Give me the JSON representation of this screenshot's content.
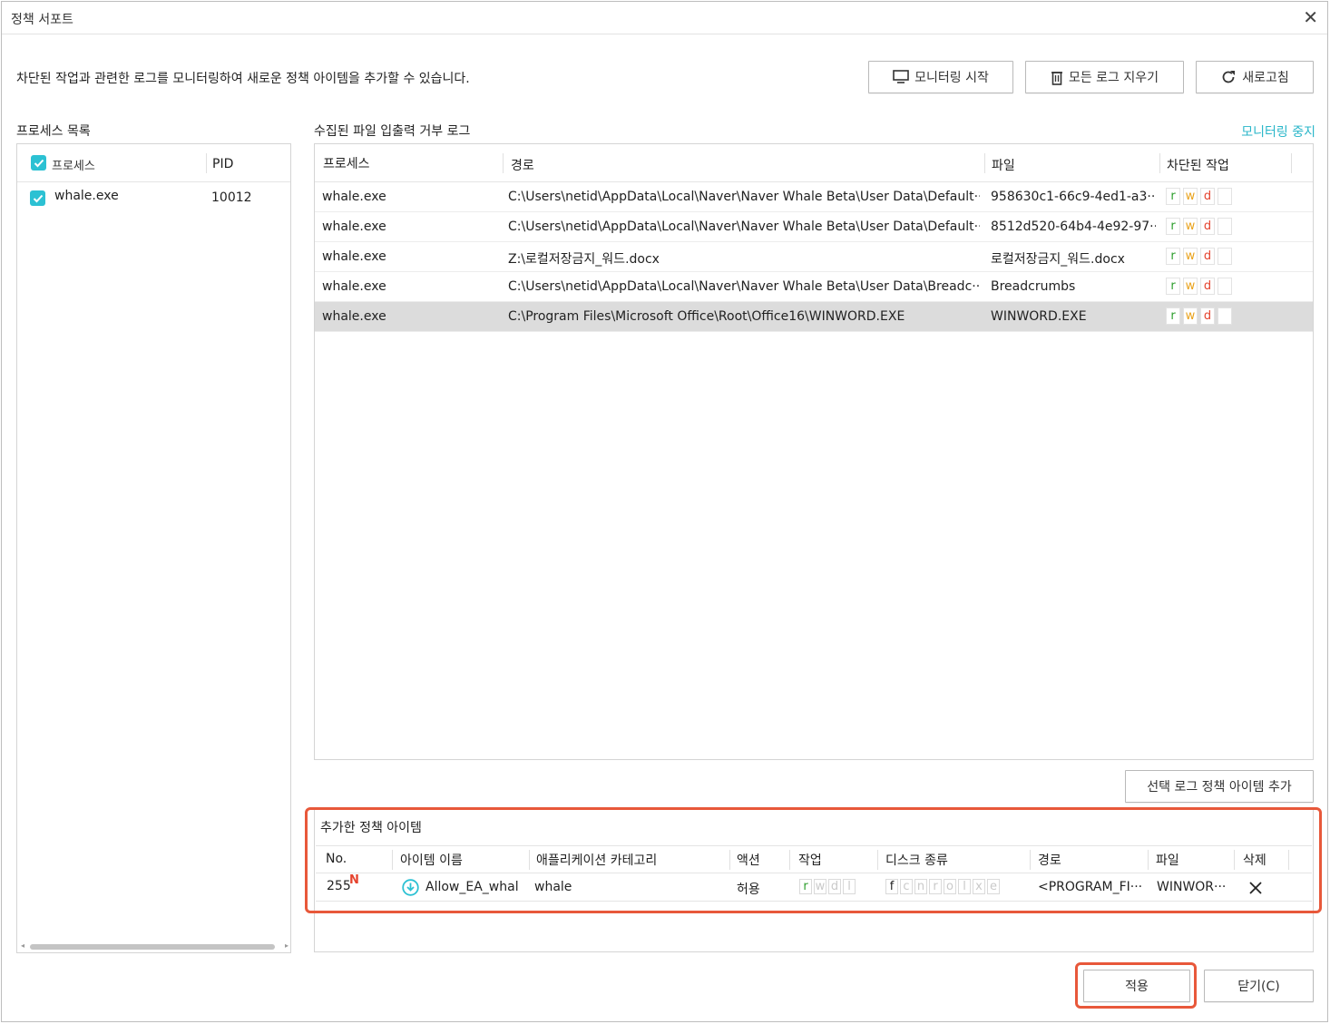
{
  "window": {
    "title": "정책 서포트"
  },
  "description": "차단된 작업과 관련한 로그를 모니터링하여 새로운 정책 아이템을 추가할 수 있습니다.",
  "toolbar": {
    "start_monitoring": "모니터링 시작",
    "clear_logs": "모든 로그 지우기",
    "refresh": "새로고침"
  },
  "process_list": {
    "label": "프로세스 목록",
    "headers": {
      "process": "프로세스",
      "pid": "PID"
    },
    "rows": [
      {
        "name": "whale.exe",
        "pid": "10012",
        "checked": true
      }
    ]
  },
  "log": {
    "label": "수집된 파일 입출력 거부 로그",
    "stop_link": "모니터링 중지",
    "headers": {
      "process": "프로세스",
      "path": "경로",
      "file": "파일",
      "blocked": "차단된 작업"
    },
    "rows": [
      {
        "process": "whale.exe",
        "path": "C:\\Users\\netid\\AppData\\Local\\Naver\\Naver Whale Beta\\User Data\\Default···",
        "file": "958630c1-66c9-4ed1-a3···",
        "ops": [
          "r",
          "w",
          "d"
        ],
        "selected": false
      },
      {
        "process": "whale.exe",
        "path": "C:\\Users\\netid\\AppData\\Local\\Naver\\Naver Whale Beta\\User Data\\Default···",
        "file": "8512d520-64b4-4e92-97···",
        "ops": [
          "r",
          "w",
          "d"
        ],
        "selected": false
      },
      {
        "process": "whale.exe",
        "path": "Z:\\로컬저장금지_워드.docx",
        "file": "로컬저장금지_워드.docx",
        "ops": [
          "r",
          "w",
          "d"
        ],
        "selected": false
      },
      {
        "process": "whale.exe",
        "path": "C:\\Users\\netid\\AppData\\Local\\Naver\\Naver Whale Beta\\User Data\\Breadc···",
        "file": "Breadcrumbs",
        "ops": [
          "r",
          "w",
          "d"
        ],
        "selected": false
      },
      {
        "process": "whale.exe",
        "path": "C:\\Program Files\\Microsoft Office\\Root\\Office16\\WINWORD.EXE",
        "file": "WINWORD.EXE",
        "ops": [
          "r",
          "w",
          "d"
        ],
        "selected": true
      }
    ],
    "add_button": "선택 로그 정책 아이템 추가"
  },
  "added": {
    "label": "추가한 정책 아이템",
    "headers": {
      "no": "No.",
      "name": "아이템 이름",
      "category": "애플리케이션 카테고리",
      "action": "액션",
      "ops": "작업",
      "disk": "디스크 종류",
      "path": "경로",
      "file": "파일",
      "delete": "삭제"
    },
    "rows": [
      {
        "no": "255",
        "new_badge": "N",
        "name": "Allow_EA_whal",
        "category": "whale",
        "action": "허용",
        "ops": [
          "r",
          "w",
          "d",
          "l"
        ],
        "disk": [
          "f",
          "c",
          "n",
          "r",
          "o",
          "l",
          "x",
          "e"
        ],
        "path": "<PROGRAM_FI···",
        "file": "WINWOR···"
      }
    ]
  },
  "footer": {
    "apply": "적용",
    "close": "닫기(C)"
  },
  "colors": {
    "accent": "#2cc1d3",
    "highlight": "#e8583a",
    "op_r": "#2e9e2e",
    "op_w": "#e9a21b",
    "op_d": "#e5432e"
  }
}
